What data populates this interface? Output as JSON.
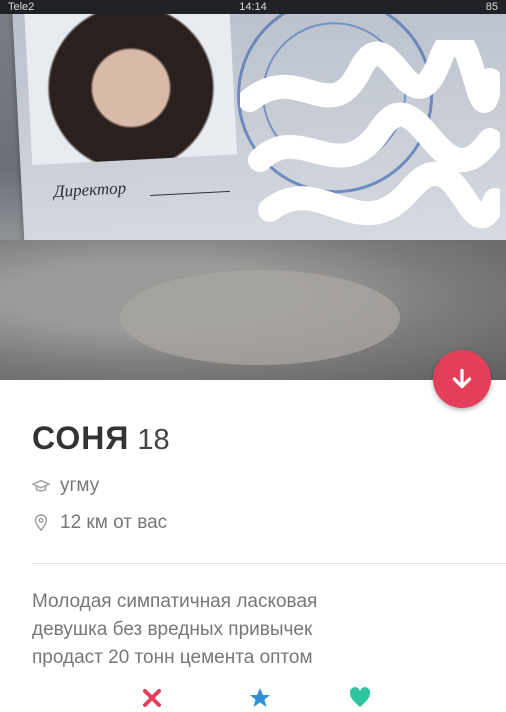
{
  "status_bar": {
    "carrier": "Tele2",
    "time": "14:14",
    "battery": "85"
  },
  "photo": {
    "card_text": "Директор"
  },
  "profile": {
    "name": "СОНЯ",
    "age": "18",
    "school": "угму",
    "distance": "12 км от вас",
    "bio": "Молодая симпатичная ласковая\nдевушка без вредных привычек\nпродаст 20 тонн цемента оптом"
  },
  "icons": {
    "fab": "arrow-down-icon",
    "school": "graduation-cap-icon",
    "distance": "location-pin-icon",
    "actions": [
      "close-icon",
      "star-icon",
      "heart-icon"
    ]
  },
  "colors": {
    "accent": "#e33f5a",
    "superlike": "#2f90d8",
    "like": "#2ec4a0"
  }
}
